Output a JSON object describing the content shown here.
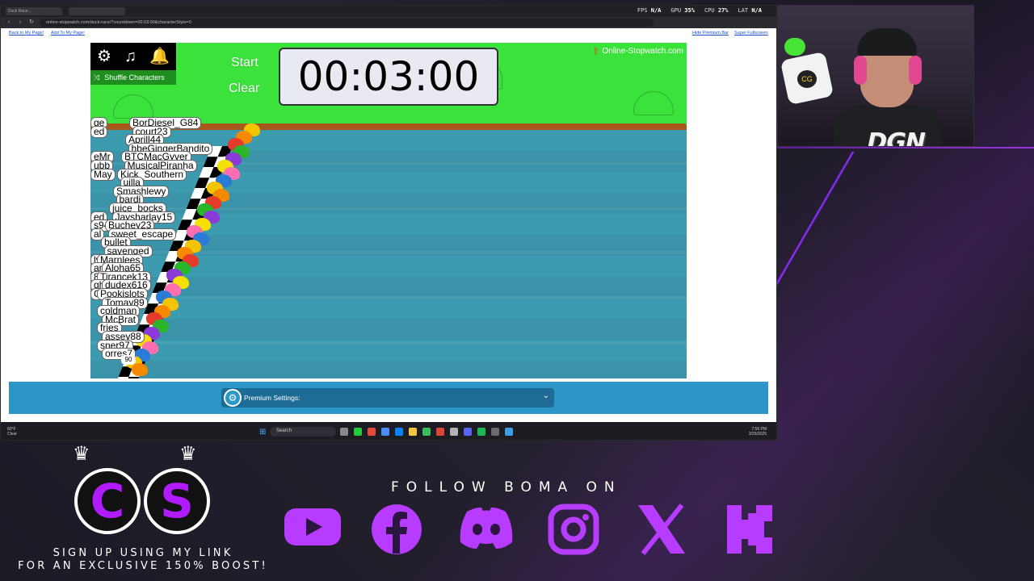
{
  "browser": {
    "tab_label": "Duck Race...",
    "url": "online-stopwatch.com/duck-race/?countdown=00:03:00&characterStyle=0",
    "hud": {
      "fps_label": "FPS",
      "fps_value": "N/A",
      "gpu_label": "GPU",
      "gpu_value": "35%",
      "cpu_label": "CPU",
      "cpu_value": "27%",
      "lat_label": "LAT",
      "lat_value": "N/A"
    }
  },
  "page": {
    "back_link": "Back to My Page!",
    "add_link": "Add To My Page!",
    "hide_premium_link": "Hide Premium Bar",
    "fullscreen_link": "Super Fullscreen"
  },
  "game": {
    "settings_icon": "gear-icon",
    "music_icon": "music-icon",
    "sound_icon": "bell-icon",
    "shuffle_label": "Shuffle Characters",
    "start_label": "Start",
    "clear_label": "Clear",
    "timer": "00:03:00",
    "brand": "Online-Stopwatch.com",
    "duck_number": "90",
    "names": [
      "ge",
      "BorDiesel_G84",
      "ed",
      "court23",
      "Aprill44",
      "hbeGingerBandito",
      "eMr",
      "BTCMacGyver",
      "ubb",
      "MusicalPiranha",
      "May",
      "Kick_Southern",
      "uilla",
      "Smashlewy",
      "bardi",
      "juice_bocks",
      "ed",
      "Jaysharlay15",
      "s94",
      "Buchey23",
      "al",
      "sweet_escape",
      "bullet",
      "savenged",
      "ly85",
      "Marnlees",
      "and",
      "Aloha65",
      "8",
      "Tirancek13",
      "ght",
      "dudex616",
      "ib",
      "GSXR",
      "Pookislots",
      "Tomay89",
      "coldman",
      "McBrat",
      "fries",
      "assey88",
      "sner97",
      "orres7"
    ]
  },
  "premium": {
    "label": "Premium Settings:"
  },
  "taskbar": {
    "weather_temp": "60°F",
    "weather_desc": "Clear",
    "search_placeholder": "Search",
    "clock_time": "7:56 PM",
    "clock_date": "3/25/2025"
  },
  "webcam": {
    "logo": "DGN",
    "pillow_logo": "CG"
  },
  "overlay": {
    "cs_left": "C",
    "cs_right": "S",
    "signup_line1": "SIGN UP USING MY LINK",
    "signup_line2": "FOR AN EXCLUSIVE 150% BOOST!",
    "follow_text": "FOLLOW BOMA ON",
    "socials": [
      "youtube-icon",
      "facebook-icon",
      "discord-icon",
      "instagram-icon",
      "x-icon",
      "kick-icon"
    ]
  },
  "colors": {
    "sky": "#3be23b",
    "water": "#3d9bb0",
    "premium_strip": "#2b96c7",
    "accent_purple": "#b73cff"
  }
}
